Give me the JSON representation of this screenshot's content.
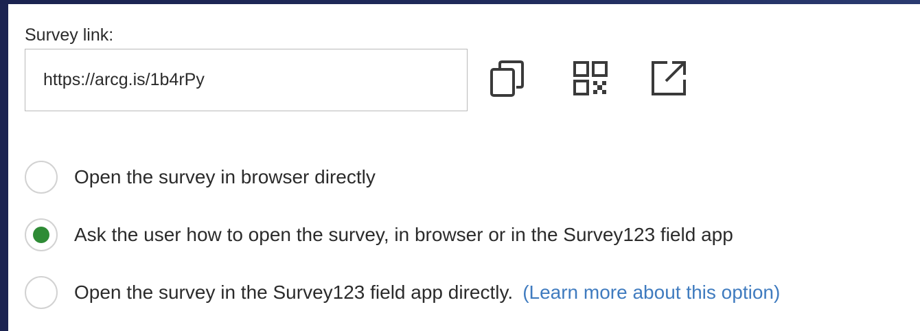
{
  "survey_link": {
    "label": "Survey link:",
    "value": "https://arcg.is/1b4rPy"
  },
  "actions": {
    "copy_icon": "copy-icon",
    "qr_icon": "qr-code-icon",
    "open_icon": "open-in-new-window-icon"
  },
  "options": [
    {
      "label": "Open the survey in browser directly",
      "selected": false
    },
    {
      "label": "Ask the user how to open the survey, in browser or in the Survey123 field app",
      "selected": true
    },
    {
      "label": "Open the survey in the Survey123 field app directly.",
      "selected": false,
      "link": "(Learn more about this option)"
    }
  ],
  "colors": {
    "frame": "#1c2451",
    "radio_selected": "#2e8b35",
    "link": "#3f7bbf",
    "icon": "#3a3a3a"
  }
}
